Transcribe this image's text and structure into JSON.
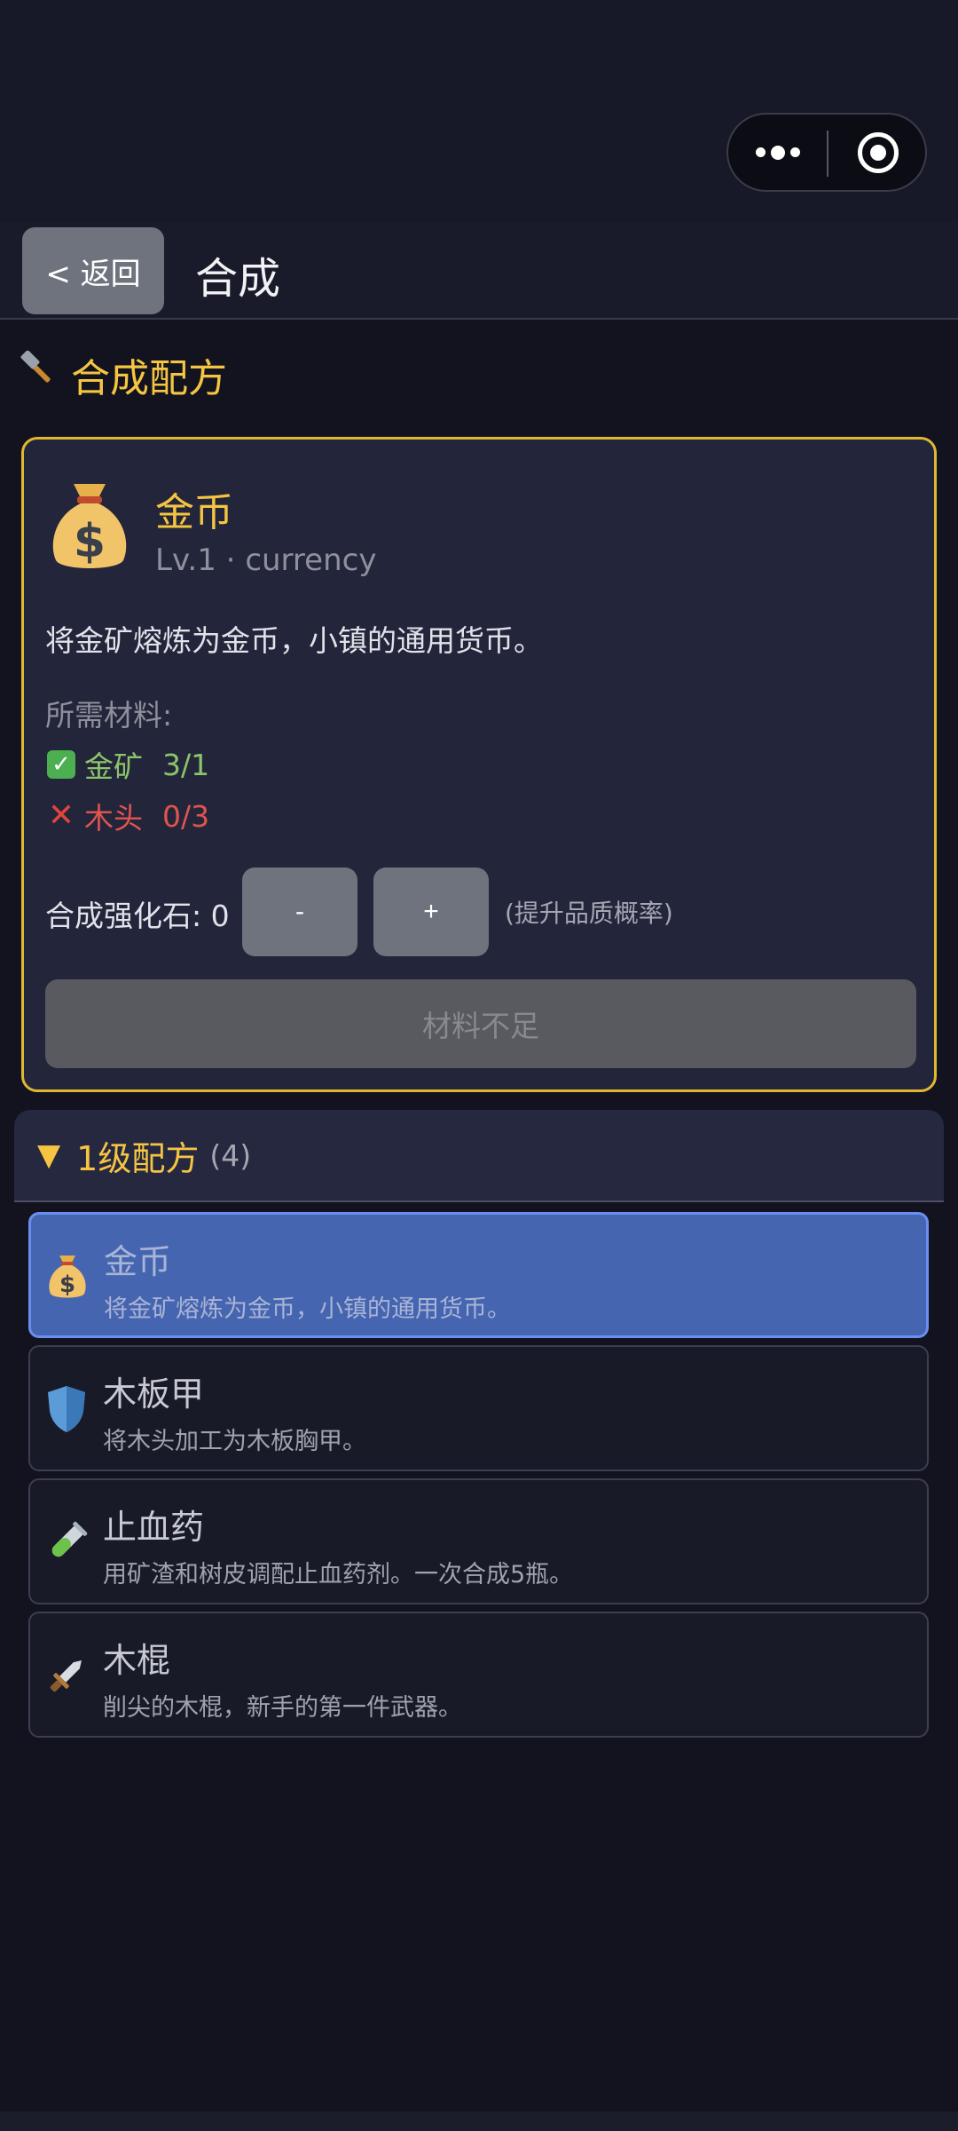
{
  "header": {
    "back_label": "< 返回",
    "title": "合成"
  },
  "section": {
    "title": "合成配方",
    "icon": "hammer-icon"
  },
  "detail": {
    "icon": "money-bag-icon",
    "name": "金币",
    "level": "Lv.1",
    "separator": " · ",
    "category": "currency",
    "description": "将金矿熔炼为金币，小镇的通用货币。",
    "materials_label": "所需材料:",
    "materials": [
      {
        "status": "ok",
        "name": "金矿",
        "qty": "3/1"
      },
      {
        "status": "missing",
        "name": "木头",
        "qty": "0/3"
      }
    ],
    "stone_label": "合成强化石: 0",
    "minus_label": "-",
    "plus_label": "+",
    "stone_hint": "(提升品质概率)",
    "craft_label": "材料不足",
    "accent_color": "#e0b830"
  },
  "group": {
    "arrow": "▼",
    "title": "1级配方",
    "count": "(4)"
  },
  "recipes": [
    {
      "icon": "money-bag-icon",
      "name": "金币",
      "description": "将金矿熔炼为金币，小镇的通用货币。",
      "selected": true
    },
    {
      "icon": "shield-icon",
      "name": "木板甲",
      "description": "将木头加工为木板胸甲。",
      "selected": false
    },
    {
      "icon": "test-tube-icon",
      "name": "止血药",
      "description": "用矿渣和树皮调配止血药剂。一次合成5瓶。",
      "selected": false
    },
    {
      "icon": "dagger-icon",
      "name": "木棍",
      "description": "削尖的木棍，新手的第一件武器。",
      "selected": false
    }
  ]
}
